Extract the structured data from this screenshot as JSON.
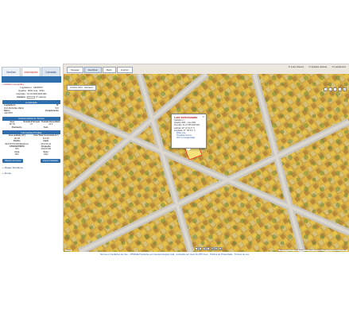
{
  "left_panel": {
    "tabs": [
      "Geofício",
      "Informações",
      "Camadas"
    ],
    "active_tab": "Informações",
    "title": "Cadastro Geográfico",
    "lote_info": {
      "logradouro": "Logradouro : CENTRO",
      "quadra": "Quadra : 0001 Lote : 0341",
      "inscricao": "Inscrição : 01.13.356.0234.001",
      "cartorio_label": "Cartório :",
      "cartorio_value": "3º cartório"
    },
    "sections": {
      "localizacao": "Localização",
      "lot_header": [
        "Logradouro",
        "Nº"
      ],
      "lot_values": [
        "RUA MANOEL MENA",
        "547"
      ],
      "bairro_header": [
        "Bairro",
        "Complemento"
      ],
      "bairro_values": [
        "CENTRO",
        ""
      ],
      "caracteristicas": "Características do Terreno",
      "area_header": [
        "Área",
        "Testada Principal",
        "Testada Secundária"
      ],
      "area_values": [
        "367.50",
        "15",
        "24.5"
      ],
      "padrao_header": [
        "Pavimento",
        "Solo"
      ],
      "padrao_values": [
        "",
        ""
      ],
      "edificacao": "Informações Prediais",
      "edif_header": [
        "Área unidade (m²)",
        "Área Total Construída (m²)"
      ],
      "edif_values": [
        "152.96",
        "201.58"
      ],
      "uso_header": [
        "Padrão",
        "Idade"
      ],
      "uso_values": [
        "RESTRITO RESIDENCIAL",
        "2013-08-10"
      ],
      "tipo_header": [
        "ATIVO/EXTINTO",
        "Ocupação"
      ],
      "tipo_values": [
        "SIM",
        "ARQUIVAR"
      ],
      "zona_header": [
        "Zona",
        "Setor"
      ],
      "zona_values": [
        "ZR2",
        "0002"
      ]
    },
    "buttons": {
      "left": "Histórico do Imóvel",
      "right": "Imprimir Relatório"
    },
    "expanders": [
      "Mapas Temáticos",
      "Zonas"
    ]
  },
  "map": {
    "tabs": [
      "Navegar",
      "Identificar",
      "Medir",
      "Imprimir"
    ],
    "active_tab": "Identificar",
    "basemap": "Ortofoto 2021 - Ilustrativo",
    "layers": [
      "Lotes urbanos",
      "Quadras urbanas",
      "Logradouros"
    ],
    "zoom": [
      "+",
      "−",
      "⌂",
      "⤢",
      "⚲"
    ],
    "popup": {
      "title": "Lote selecionado",
      "lines": [
        "Cadastro n.º:",
        "Quadra: 0001 - Lote 0341",
        "Inscrição: 01.13.356.0234.001",
        "Latitude: 22° 41' 41.5'' S",
        "Longitude: 47° 38' 5.4'' O"
      ],
      "links": [
        "Editar Lote",
        "Visualizar Anexos",
        "Abrir no Google Maps"
      ]
    },
    "bottom_tools": [
      "⤺",
      "✎",
      "↺",
      "□",
      "✚",
      "⊕",
      "⊖"
    ],
    "attribution": "Dados do mapa ©2021 Google   Imagens ©2021 Maxar Technologies   Termos de Uso   Informar erro no mapa",
    "scale": "Google"
  },
  "footer": "Termos e Condições de Uso  ·  ©PMGEO Soluções em Geotecnologias Ltda  ·  produção por meio do MTK Geo  ·  Política de Privacidade  ·  Termos de uso"
}
